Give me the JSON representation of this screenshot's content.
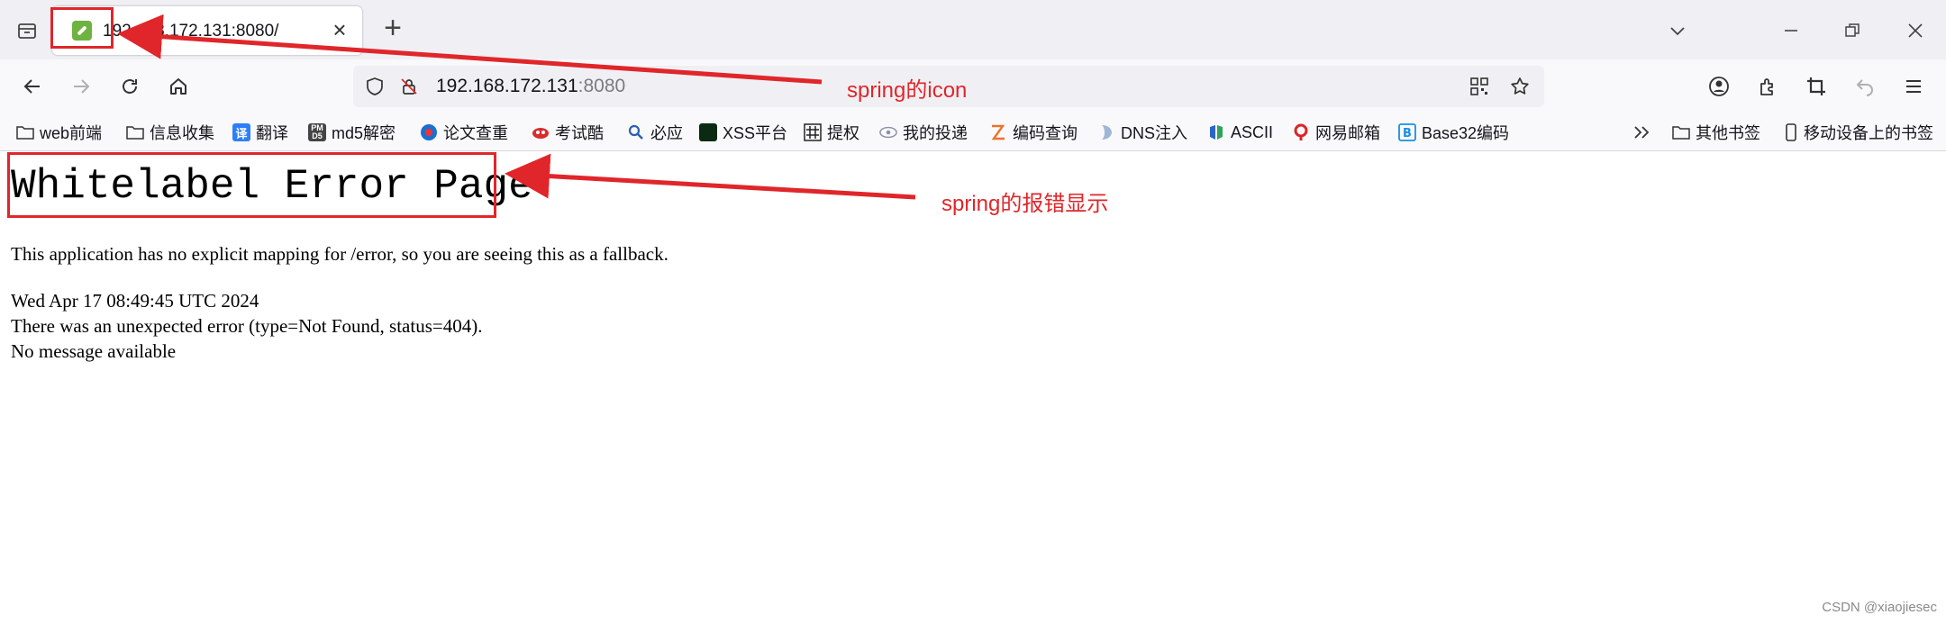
{
  "tab": {
    "title": "192.168.172.131:8080/"
  },
  "urlbar": {
    "host": "192.168.172.131",
    "port": ":8080"
  },
  "bookmarks": [
    {
      "label": "web前端",
      "icon": "folder-icon"
    },
    {
      "label": "信息收集",
      "icon": "folder-icon"
    },
    {
      "label": "翻译",
      "icon": "translate-icon"
    },
    {
      "label": "md5解密",
      "icon": "md5-icon"
    },
    {
      "label": "论文查重",
      "icon": "paper-check-icon"
    },
    {
      "label": "考试酷",
      "icon": "exam-icon"
    },
    {
      "label": "必应",
      "icon": "bing-search-icon"
    },
    {
      "label": "XSS平台",
      "icon": "xss-icon"
    },
    {
      "label": "提权",
      "icon": "privesc-icon"
    },
    {
      "label": "我的投递",
      "icon": "delivery-icon"
    },
    {
      "label": "编码查询",
      "icon": "encoding-icon"
    },
    {
      "label": "DNS注入",
      "icon": "dns-icon"
    },
    {
      "label": "ASCII",
      "icon": "ascii-icon"
    },
    {
      "label": "网易邮箱",
      "icon": "netease-mail-icon"
    },
    {
      "label": "Base32编码",
      "icon": "base32-icon"
    }
  ],
  "bookmarks_right": {
    "other": "其他书签",
    "mobile": "移动设备上的书签"
  },
  "page": {
    "title": "Whitelabel Error Page",
    "description": "This application has no explicit mapping for /error, so you are seeing this as a fallback.",
    "timestamp": "Wed Apr 17 08:49:45 UTC 2024",
    "error": "There was an unexpected error (type=Not Found, status=404).",
    "message": "No message available"
  },
  "annotations": {
    "icon_note": "spring的icon",
    "error_note": "spring的报错显示",
    "color": "#e0262a"
  },
  "watermark": "CSDN @xiaojiesec"
}
